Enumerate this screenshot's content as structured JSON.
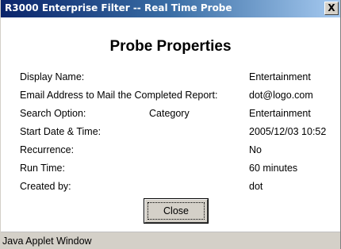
{
  "window": {
    "title": "R3000 Enterprise Filter -- Real Time Probe",
    "close_glyph": "X"
  },
  "heading": "Probe Properties",
  "properties": [
    {
      "label": "Display Name:",
      "sub": "",
      "value": "Entertainment"
    },
    {
      "label": "Email Address to Mail the Completed Report:",
      "sub": "",
      "value": "dot@logo.com"
    },
    {
      "label": "Search Option:",
      "sub": "Category",
      "value": "Entertainment"
    },
    {
      "label": "Start Date & Time:",
      "sub": "",
      "value": "2005/12/03 10:52"
    },
    {
      "label": "Recurrence:",
      "sub": "",
      "value": "No"
    },
    {
      "label": "Run Time:",
      "sub": "",
      "value": "60 minutes"
    },
    {
      "label": "Created by:",
      "sub": "",
      "value": "dot"
    }
  ],
  "close_button": "Close",
  "status": "Java Applet Window"
}
